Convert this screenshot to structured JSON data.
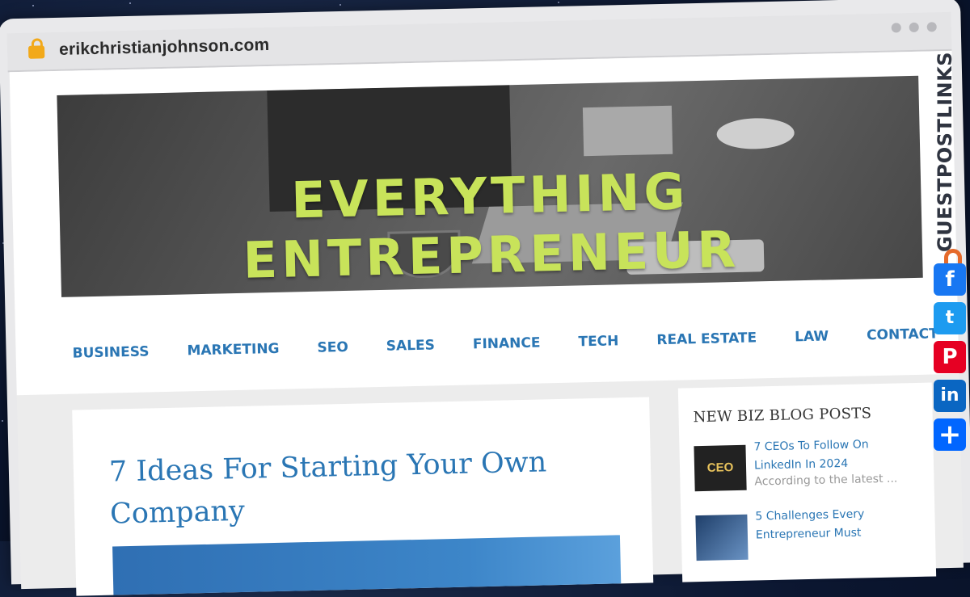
{
  "browser": {
    "url": "erikchristianjohnson.com"
  },
  "banner": {
    "title": "EVERYTHING ENTREPRENEUR"
  },
  "nav": {
    "items": [
      "BUSINESS",
      "MARKETING",
      "SEO",
      "SALES",
      "FINANCE",
      "TECH",
      "REAL ESTATE",
      "LAW",
      "CONTACT"
    ]
  },
  "post": {
    "title": "7 Ideas For Starting Your Own Company"
  },
  "sidebar": {
    "title": "NEW BIZ BLOG POSTS",
    "posts": [
      {
        "thumb_text": "CEO",
        "title": "7 CEOs To Follow On LinkedIn In 2024",
        "excerpt": "According to the latest ..."
      },
      {
        "thumb_text": "",
        "title": "5 Challenges Every Entrepreneur Must",
        "excerpt": ""
      }
    ]
  },
  "brand": {
    "logo_text": "GUESTPOSTLINKS"
  },
  "share": {
    "facebook": "f",
    "twitter": "t",
    "pinterest": "P",
    "linkedin": "in",
    "more": "+"
  },
  "colors": {
    "link_blue": "#2a76b4",
    "banner_green": "#c8e35a",
    "accent_orange": "#e56a2b"
  }
}
